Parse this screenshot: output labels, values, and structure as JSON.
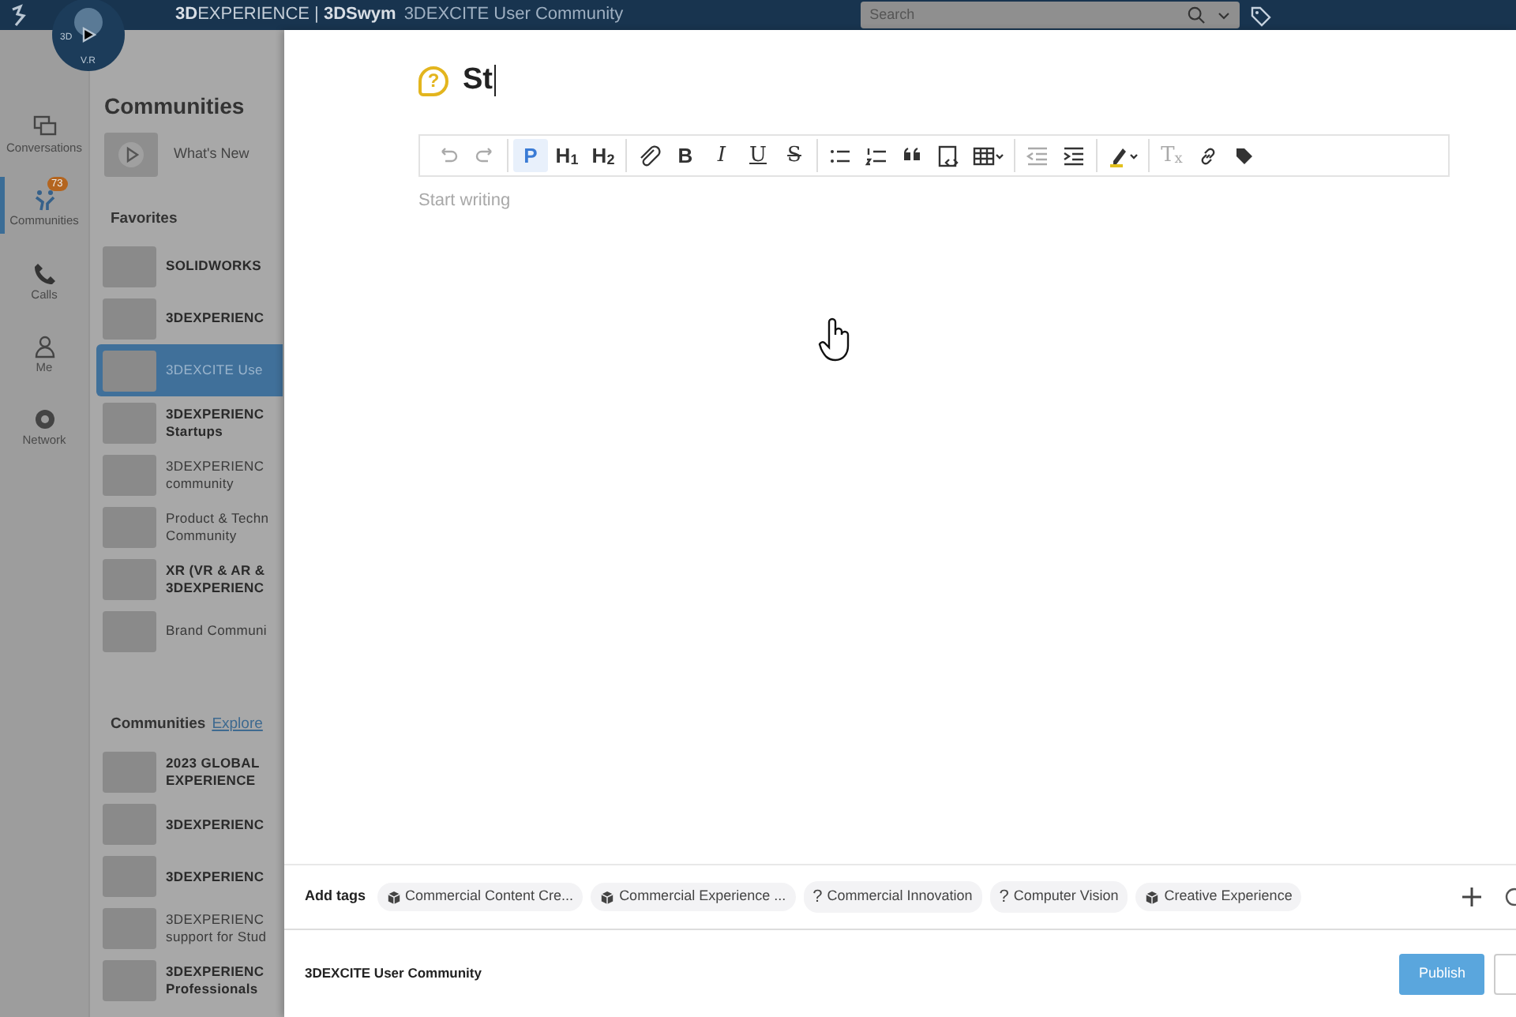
{
  "topbar": {
    "brand": "**3D**EXPERIENCE | **3DSwym**",
    "context": "3DEXCITE User Community",
    "search": {
      "placeholder": "Search"
    }
  },
  "compass": {
    "labels": [
      "3D",
      "V.R"
    ]
  },
  "sidebar": {
    "items": [
      {
        "label": "Conversations",
        "kind": "chat",
        "selected": false
      },
      {
        "label": "Communities",
        "kind": "community",
        "selected": true,
        "badge": "73"
      },
      {
        "label": "Calls",
        "kind": "phone",
        "selected": false
      },
      {
        "label": "Me",
        "kind": "person",
        "selected": false
      },
      {
        "label": "Network",
        "kind": "network",
        "selected": false
      }
    ]
  },
  "panel": {
    "title": "Communities",
    "whats_new": "What's New",
    "favorites": {
      "heading": "Favorites",
      "items": [
        {
          "lines": [
            "SOLIDWORKS"
          ],
          "unread": true,
          "selected": false
        },
        {
          "lines": [
            "3DEXPERIENC"
          ],
          "unread": true,
          "selected": false
        },
        {
          "lines": [
            "3DEXCITE Use"
          ],
          "unread": false,
          "selected": true
        },
        {
          "lines": [
            "3DEXPERIENC",
            "Startups"
          ],
          "unread": true,
          "selected": false
        },
        {
          "lines": [
            "3DEXPERIENC",
            "community"
          ],
          "unread": false,
          "selected": false
        },
        {
          "lines": [
            "Product & Techn",
            "Community"
          ],
          "unread": false,
          "selected": false
        },
        {
          "lines": [
            "XR (VR & AR &",
            "3DEXPERIENC"
          ],
          "unread": true,
          "selected": false
        },
        {
          "lines": [
            "Brand Communi"
          ],
          "unread": false,
          "selected": false
        }
      ]
    },
    "communities": {
      "heading": "Communities",
      "link": "Explore",
      "items": [
        {
          "lines": [
            "2023 GLOBAL",
            "EXPERIENCE"
          ],
          "unread": true,
          "selected": false
        },
        {
          "lines": [
            "3DEXPERIENC"
          ],
          "unread": true,
          "selected": false
        },
        {
          "lines": [
            "3DEXPERIENC"
          ],
          "unread": true,
          "selected": false
        },
        {
          "lines": [
            "3DEXPERIENC",
            "support for Stud"
          ],
          "unread": false,
          "selected": false
        },
        {
          "lines": [
            "3DEXPERIENC",
            "Professionals"
          ],
          "unread": true,
          "selected": false
        }
      ]
    }
  },
  "editor": {
    "title_glyph": "?",
    "title": "St",
    "toolbar": [
      [
        {
          "kind": "undo",
          "disabled": true
        },
        {
          "kind": "redo",
          "disabled": true
        }
      ],
      [
        {
          "kind": "text",
          "label": "P",
          "selected": true
        },
        {
          "kind": "text",
          "label": "H$_{1}$",
          "selected": false
        },
        {
          "kind": "text",
          "label": "H$_{2}$",
          "selected": false
        }
      ],
      [
        {
          "kind": "attach"
        },
        {
          "kind": "bold",
          "label": "B"
        },
        {
          "kind": "italic",
          "label": "I"
        },
        {
          "kind": "underline",
          "label": "U"
        },
        {
          "kind": "strike",
          "label": "S"
        }
      ],
      [
        {
          "kind": "bullets"
        },
        {
          "kind": "numbers"
        },
        {
          "kind": "quote"
        },
        {
          "kind": "embed"
        },
        {
          "kind": "table"
        }
      ],
      [
        {
          "kind": "outdent",
          "disabled": true
        },
        {
          "kind": "indent",
          "disabled": false
        }
      ],
      [
        {
          "kind": "highlight"
        }
      ],
      [
        {
          "kind": "clear",
          "label": "T$_{x}$",
          "disabled": true
        },
        {
          "kind": "link"
        },
        {
          "kind": "tag"
        }
      ]
    ],
    "placeholder": "Start writing"
  },
  "tags": {
    "label": "Add tags",
    "chips": [
      {
        "kind": "cube",
        "label": "Commercial Content Cre..."
      },
      {
        "kind": "cube",
        "label": "Commercial Experience ..."
      },
      {
        "kind": "glyph",
        "glyph": "?",
        "label": "Commercial Innovation"
      },
      {
        "kind": "glyph",
        "glyph": "?",
        "label": "Computer Vision"
      },
      {
        "kind": "cube",
        "label": "Creative Experience"
      }
    ]
  },
  "footer": {
    "community": "3DEXCITE User Community",
    "publish": "Publish"
  }
}
